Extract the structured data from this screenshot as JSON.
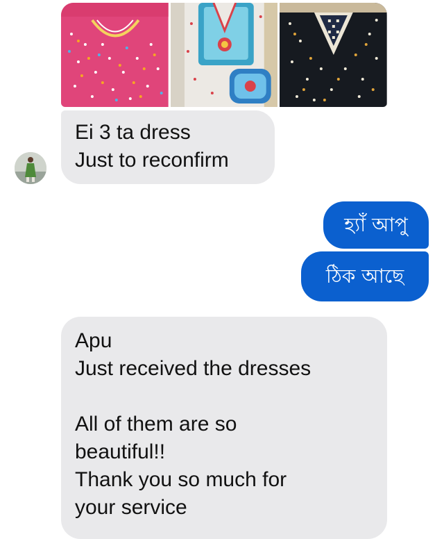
{
  "conversation": {
    "shared_photos": [
      {
        "icon": "pink-embroidered-kurti-photo"
      },
      {
        "icon": "white-blue-embroidered-kurti-photo"
      },
      {
        "icon": "black-embroidered-kurti-photo"
      }
    ],
    "messages": [
      {
        "sender": "contact",
        "lines": [
          "Ei 3 ta dress",
          "Just to reconfirm"
        ]
      },
      {
        "sender": "me",
        "lines": [
          "হ্যাঁ আপু"
        ]
      },
      {
        "sender": "me",
        "lines": [
          "ঠিক আছে"
        ]
      },
      {
        "sender": "contact",
        "lines": [
          "Apu",
          "Just received the dresses",
          "",
          "All of them are so",
          "beautiful!!",
          "Thank you so much for",
          "your service"
        ]
      }
    ]
  },
  "colors": {
    "incoming_bubble": "#e9e9eb",
    "outgoing_bubble": "#0b60cf",
    "outgoing_text": "#ffffff"
  }
}
